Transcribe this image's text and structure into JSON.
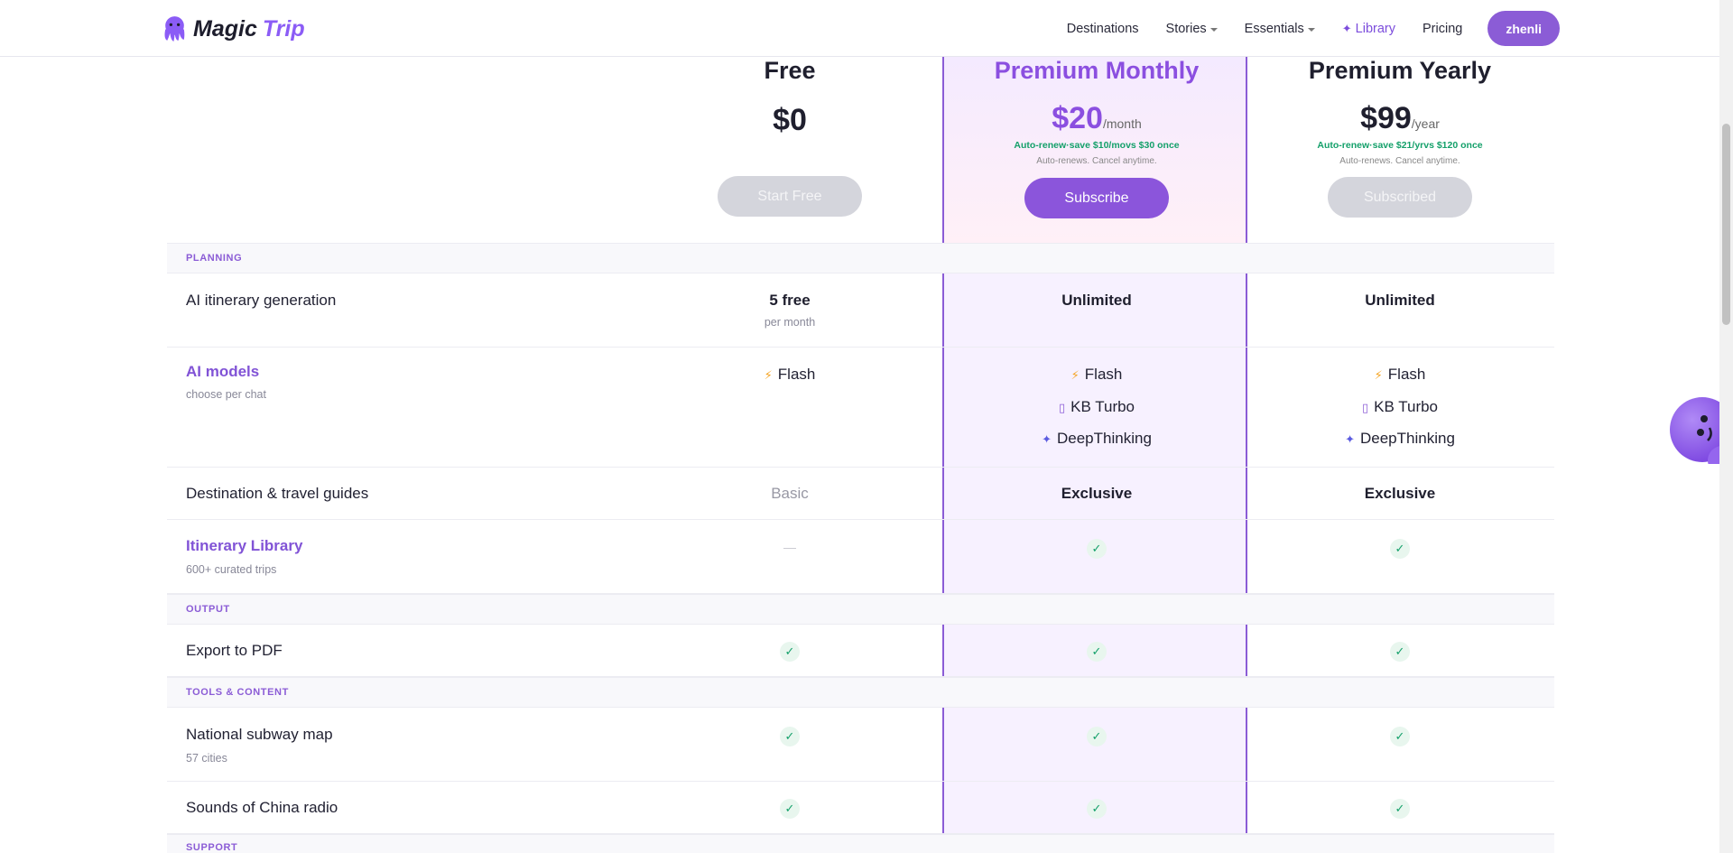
{
  "nav": {
    "brand_word1": "Magic",
    "brand_word2": "Trip",
    "links": [
      {
        "label": "Destinations"
      },
      {
        "label": "Stories"
      },
      {
        "label": "Essentials"
      },
      {
        "label": "Library"
      },
      {
        "label": "Pricing"
      }
    ],
    "user": "zhenli"
  },
  "plans": [
    {
      "name": "Free",
      "price": "$0",
      "unit": "",
      "renew": "",
      "cancel": "",
      "button": "Start Free"
    },
    {
      "name": "Premium Monthly",
      "price": "$20",
      "unit": "/month",
      "renew": "Auto-renew·save $10/movs $30 once",
      "cancel": "Auto-renews. Cancel anytime.",
      "button": "Subscribe"
    },
    {
      "name": "Premium Yearly",
      "price": "$99",
      "unit": "/year",
      "renew": "Auto-renew·save $21/yrvs $120 once",
      "cancel": "Auto-renews. Cancel anytime.",
      "button": "Subscribed"
    }
  ],
  "sections": {
    "planning": "PLANNING",
    "output": "OUTPUT",
    "tools": "TOOLS & CONTENT",
    "support": "SUPPORT"
  },
  "features": {
    "ai_itinerary": {
      "label": "AI itinerary generation",
      "free": "5 free",
      "free_sub": "per month",
      "monthly": "Unlimited",
      "yearly": "Unlimited"
    },
    "ai_models": {
      "label": "AI models",
      "sub": "choose per chat",
      "models": [
        "Flash",
        "KB Turbo",
        "DeepThinking"
      ]
    },
    "guides": {
      "label": "Destination & travel guides",
      "free": "Basic",
      "monthly": "Exclusive",
      "yearly": "Exclusive"
    },
    "library": {
      "label": "Itinerary Library",
      "sub": "600+ curated trips",
      "free": "—",
      "check": "✓"
    },
    "pdf": {
      "label": "Export to PDF"
    },
    "subway": {
      "label": "National subway map",
      "sub": "57 cities"
    },
    "radio": {
      "label": "Sounds of China radio"
    }
  },
  "colors": {
    "accent": "#8b5cd6",
    "check_green": "#14a06a",
    "bolt": "#f5a524"
  }
}
